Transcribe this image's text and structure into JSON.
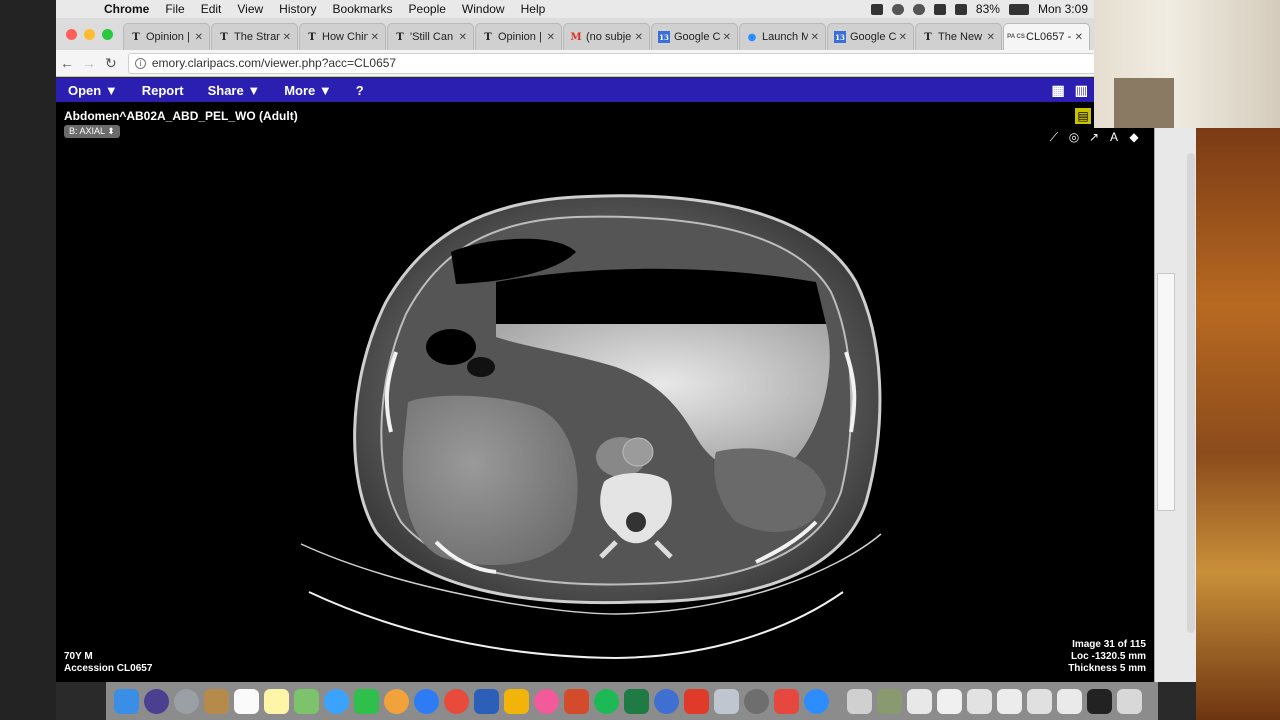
{
  "menubar": {
    "app_name": "Chrome",
    "items": [
      "File",
      "Edit",
      "View",
      "History",
      "Bookmarks",
      "People",
      "Window",
      "Help"
    ],
    "battery": "83%",
    "clock": "Mon 3:09"
  },
  "tabs": [
    {
      "icon": "T",
      "title": "Opinion |"
    },
    {
      "icon": "T",
      "title": "The Stran"
    },
    {
      "icon": "T",
      "title": "How Chin"
    },
    {
      "icon": "T",
      "title": "'Still Can"
    },
    {
      "icon": "T",
      "title": "Opinion |"
    },
    {
      "icon": "M",
      "title": "(no subje"
    },
    {
      "icon": "13",
      "title": "Google C"
    },
    {
      "icon": "●",
      "title": "Launch M"
    },
    {
      "icon": "13",
      "title": "Google C"
    },
    {
      "icon": "T",
      "title": "The New"
    },
    {
      "icon": "PA CS",
      "title": "CL0657 -"
    }
  ],
  "address": {
    "url": "emory.claripacs.com/viewer.php?acc=CL0657"
  },
  "appbar": {
    "menus": [
      "Open ▼",
      "Report",
      "Share ▼",
      "More ▼",
      "?"
    ]
  },
  "viewer": {
    "study_title": "Abdomen^AB02A_ABD_PEL_WO (Adult)",
    "series": "B: AXIAL ⬍",
    "patient_line1": "70Y M",
    "patient_line2": "Accession CL0657",
    "image_line1": "Image 31 of 115",
    "image_line2": "Loc -1320.5 mm",
    "image_line3": "Thickness 5 mm"
  },
  "colors": {
    "appbar": "#2a1fb0",
    "tool_highlight": "#c9c200",
    "close": "#ff5f57",
    "minimize": "#febc2e",
    "maximize": "#28c840"
  }
}
